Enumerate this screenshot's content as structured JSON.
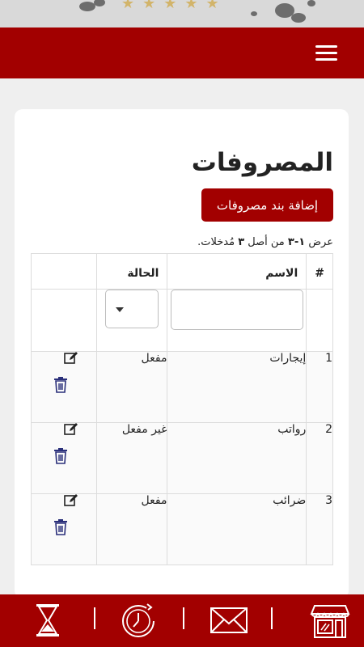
{
  "header": {
    "menu_icon": "hamburger-menu-icon"
  },
  "page": {
    "title": "المصروفات",
    "add_button_label": "إضافة بند مصروفات"
  },
  "summary": {
    "prefix": "عرض",
    "range": "١-٣",
    "middle": "من أصل",
    "total": "٣",
    "suffix": "مُدخلات."
  },
  "table": {
    "columns": {
      "index": "#",
      "name": "الاسم",
      "status": "الحالة"
    },
    "filters": {
      "name_value": "",
      "status_value": ""
    },
    "rows": [
      {
        "index": "1",
        "name": "إيجارات",
        "status": "مفعل"
      },
      {
        "index": "2",
        "name": "رواتب",
        "status": "غير مفعل"
      },
      {
        "index": "3",
        "name": "ضرائب",
        "status": "مفعل"
      }
    ]
  },
  "bottom_nav": [
    {
      "icon": "store-icon"
    },
    {
      "icon": "mail-icon"
    },
    {
      "icon": "stopwatch-icon"
    },
    {
      "icon": "hourglass-icon"
    }
  ],
  "colors": {
    "brand": "#a20000",
    "icon_blue": "#2a2f7a"
  }
}
